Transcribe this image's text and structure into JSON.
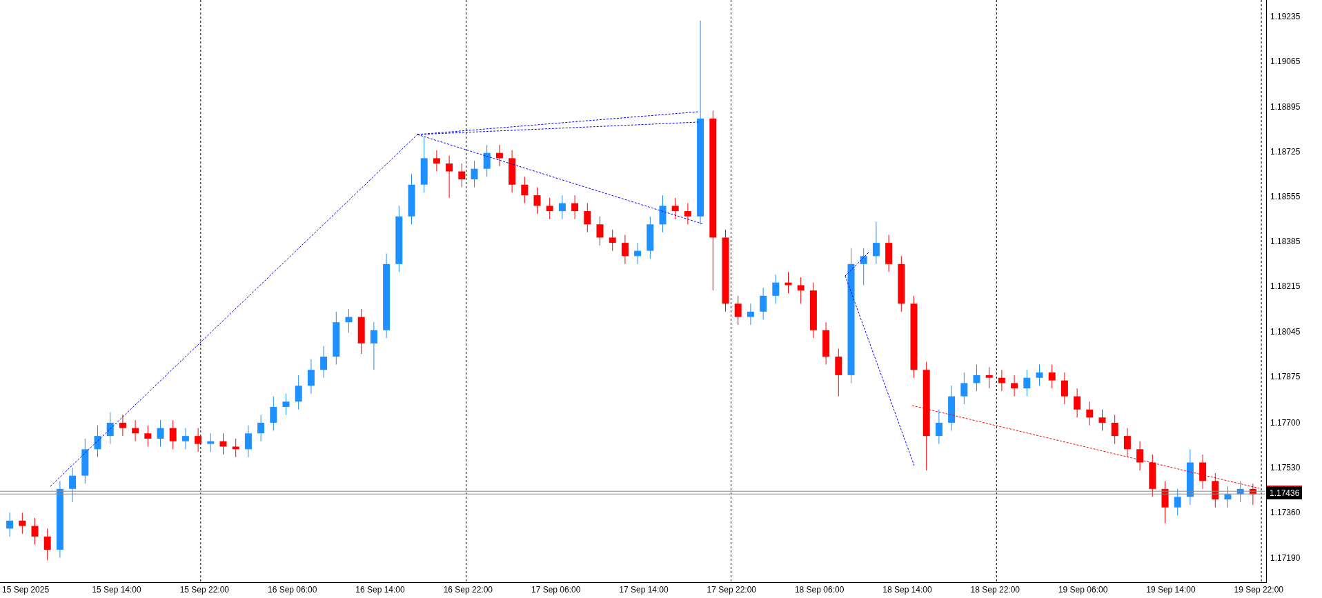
{
  "chart": {
    "chart_data": {
      "type": "candlestick",
      "ylim": [
        1.17095,
        1.19298
      ],
      "yticks": [
        {
          "value": 1.19235,
          "label": "1.19235"
        },
        {
          "value": 1.19065,
          "label": "1.19065"
        },
        {
          "value": 1.18895,
          "label": "1.18895"
        },
        {
          "value": 1.18725,
          "label": "1.18725"
        },
        {
          "value": 1.18555,
          "label": "1.18555"
        },
        {
          "value": 1.18385,
          "label": "1.18385"
        },
        {
          "value": 1.18215,
          "label": "1.18215"
        },
        {
          "value": 1.18045,
          "label": "1.18045"
        },
        {
          "value": 1.17875,
          "label": "1.17875"
        },
        {
          "value": 1.177,
          "label": "1.17700"
        },
        {
          "value": 1.1753,
          "label": "1.17530"
        },
        {
          "value": 1.1736,
          "label": "1.17360"
        },
        {
          "value": 1.1719,
          "label": "1.17190"
        }
      ],
      "categories": [
        null,
        null,
        null,
        null,
        null,
        null,
        null,
        null,
        null,
        null,
        null,
        null,
        null,
        null,
        null,
        null,
        null,
        null,
        null,
        null,
        null,
        null,
        null,
        null,
        null,
        null,
        null,
        null,
        null,
        null,
        null,
        null,
        null,
        null,
        null,
        null,
        null,
        null,
        null,
        null,
        null,
        null,
        null,
        null,
        null,
        null,
        null,
        null,
        null,
        null,
        null,
        null,
        null,
        null,
        null,
        null,
        null,
        null,
        null,
        null,
        null,
        null,
        null,
        null,
        null,
        null,
        null,
        null,
        null,
        null,
        null,
        null,
        null,
        null,
        null,
        null,
        null,
        null,
        null,
        null,
        null,
        null,
        null,
        null,
        null,
        null,
        null,
        null,
        null,
        null,
        null,
        null,
        null,
        null,
        null,
        null,
        null,
        null,
        null,
        null
      ],
      "ohlc": [
        [
          1.173,
          1.1736,
          1.1727,
          1.1733
        ],
        [
          1.1733,
          1.1736,
          1.1728,
          1.1731
        ],
        [
          1.1731,
          1.1734,
          1.1724,
          1.1727
        ],
        [
          1.1727,
          1.173,
          1.1718,
          1.1722
        ],
        [
          1.1722,
          1.1748,
          1.1719,
          1.1745
        ],
        [
          1.1745,
          1.1753,
          1.174,
          1.175
        ],
        [
          1.175,
          1.1764,
          1.1747,
          1.176
        ],
        [
          1.176,
          1.1769,
          1.1757,
          1.1765
        ],
        [
          1.1765,
          1.1774,
          1.1762,
          1.177
        ],
        [
          1.177,
          1.1773,
          1.1765,
          1.1768
        ],
        [
          1.1768,
          1.1771,
          1.1763,
          1.1766
        ],
        [
          1.1766,
          1.1769,
          1.1761,
          1.1764
        ],
        [
          1.1764,
          1.1771,
          1.1761,
          1.1768
        ],
        [
          1.1768,
          1.1771,
          1.176,
          1.1763
        ],
        [
          1.1763,
          1.1768,
          1.176,
          1.1765
        ],
        [
          1.1765,
          1.1768,
          1.1759,
          1.1762
        ],
        [
          1.1762,
          1.1766,
          1.1759,
          1.1763
        ],
        [
          1.1763,
          1.1766,
          1.1758,
          1.1761
        ],
        [
          1.1761,
          1.1764,
          1.1757,
          1.176
        ],
        [
          1.176,
          1.1769,
          1.1757,
          1.1766
        ],
        [
          1.1766,
          1.1773,
          1.1763,
          1.177
        ],
        [
          1.177,
          1.178,
          1.1767,
          1.1776
        ],
        [
          1.1776,
          1.1781,
          1.1773,
          1.1778
        ],
        [
          1.1778,
          1.1788,
          1.1775,
          1.1784
        ],
        [
          1.1784,
          1.1794,
          1.1781,
          1.179
        ],
        [
          1.179,
          1.1799,
          1.1787,
          1.1795
        ],
        [
          1.1795,
          1.1812,
          1.1792,
          1.1808
        ],
        [
          1.1808,
          1.1813,
          1.1804,
          1.181
        ],
        [
          1.181,
          1.1813,
          1.1796,
          1.18
        ],
        [
          1.18,
          1.1808,
          1.179,
          1.1805
        ],
        [
          1.1805,
          1.1834,
          1.1802,
          1.183
        ],
        [
          1.183,
          1.1852,
          1.1827,
          1.1848
        ],
        [
          1.1848,
          1.1864,
          1.1845,
          1.186
        ],
        [
          1.186,
          1.1878,
          1.1857,
          1.187
        ],
        [
          1.187,
          1.1873,
          1.1865,
          1.1868
        ],
        [
          1.1868,
          1.1871,
          1.1855,
          1.1865
        ],
        [
          1.1865,
          1.1868,
          1.1859,
          1.1862
        ],
        [
          1.1862,
          1.1869,
          1.1859,
          1.1866
        ],
        [
          1.1866,
          1.1875,
          1.1863,
          1.1872
        ],
        [
          1.1872,
          1.1875,
          1.1867,
          1.187
        ],
        [
          1.187,
          1.1873,
          1.1857,
          1.186
        ],
        [
          1.186,
          1.1863,
          1.1853,
          1.1856
        ],
        [
          1.1856,
          1.1859,
          1.1849,
          1.1852
        ],
        [
          1.1852,
          1.1855,
          1.1847,
          1.185
        ],
        [
          1.185,
          1.1856,
          1.1847,
          1.1853
        ],
        [
          1.1853,
          1.1856,
          1.1847,
          1.185
        ],
        [
          1.185,
          1.1853,
          1.1842,
          1.1845
        ],
        [
          1.1845,
          1.1848,
          1.1837,
          1.184
        ],
        [
          1.184,
          1.1843,
          1.1835,
          1.1838
        ],
        [
          1.1838,
          1.1841,
          1.183,
          1.1833
        ],
        [
          1.1833,
          1.1838,
          1.183,
          1.1835
        ],
        [
          1.1835,
          1.1848,
          1.1832,
          1.1845
        ],
        [
          1.1845,
          1.1856,
          1.1842,
          1.1852
        ],
        [
          1.1852,
          1.1855,
          1.1847,
          1.185
        ],
        [
          1.185,
          1.1853,
          1.1845,
          1.1848
        ],
        [
          1.1848,
          1.1922,
          1.1845,
          1.1885
        ],
        [
          1.1885,
          1.1888,
          1.182,
          1.184
        ],
        [
          1.184,
          1.1843,
          1.1812,
          1.1815
        ],
        [
          1.1815,
          1.1818,
          1.1807,
          1.181
        ],
        [
          1.181,
          1.1815,
          1.1807,
          1.1812
        ],
        [
          1.1812,
          1.1821,
          1.1809,
          1.1818
        ],
        [
          1.1818,
          1.1826,
          1.1815,
          1.1823
        ],
        [
          1.1823,
          1.1827,
          1.1819,
          1.1822
        ],
        [
          1.1822,
          1.1825,
          1.1815,
          1.182
        ],
        [
          1.182,
          1.1823,
          1.1802,
          1.1805
        ],
        [
          1.1805,
          1.1808,
          1.1792,
          1.1795
        ],
        [
          1.1795,
          1.1798,
          1.178,
          1.1788
        ],
        [
          1.1788,
          1.1836,
          1.1785,
          1.183
        ],
        [
          1.183,
          1.1836,
          1.1822,
          1.1833
        ],
        [
          1.1833,
          1.1846,
          1.183,
          1.1838
        ],
        [
          1.1838,
          1.1841,
          1.1827,
          1.183
        ],
        [
          1.183,
          1.1833,
          1.1812,
          1.1815
        ],
        [
          1.1815,
          1.1818,
          1.1787,
          1.179
        ],
        [
          1.179,
          1.1793,
          1.1752,
          1.1765
        ],
        [
          1.1765,
          1.1775,
          1.1762,
          1.177
        ],
        [
          1.177,
          1.1784,
          1.1767,
          1.178
        ],
        [
          1.178,
          1.1789,
          1.1777,
          1.1785
        ],
        [
          1.1785,
          1.1792,
          1.1782,
          1.1788
        ],
        [
          1.1788,
          1.1791,
          1.1783,
          1.1787
        ],
        [
          1.1787,
          1.179,
          1.1782,
          1.1785
        ],
        [
          1.1785,
          1.1788,
          1.178,
          1.1783
        ],
        [
          1.1783,
          1.179,
          1.178,
          1.1787
        ],
        [
          1.1787,
          1.1792,
          1.1784,
          1.1789
        ],
        [
          1.1789,
          1.1792,
          1.1783,
          1.1786
        ],
        [
          1.1786,
          1.1789,
          1.1777,
          1.178
        ],
        [
          1.178,
          1.1783,
          1.1772,
          1.1775
        ],
        [
          1.1775,
          1.1778,
          1.1769,
          1.1772
        ],
        [
          1.1772,
          1.1775,
          1.1767,
          1.177
        ],
        [
          1.177,
          1.1773,
          1.1762,
          1.1765
        ],
        [
          1.1765,
          1.1768,
          1.1757,
          1.176
        ],
        [
          1.176,
          1.1763,
          1.1752,
          1.1755
        ],
        [
          1.1755,
          1.1758,
          1.1742,
          1.1745
        ],
        [
          1.1745,
          1.1748,
          1.1732,
          1.1738
        ],
        [
          1.1738,
          1.1745,
          1.1735,
          1.1742
        ],
        [
          1.1742,
          1.176,
          1.1739,
          1.1755
        ],
        [
          1.1755,
          1.1758,
          1.1745,
          1.1748
        ],
        [
          1.1748,
          1.1751,
          1.1738,
          1.1741
        ],
        [
          1.1741,
          1.1746,
          1.1738,
          1.1743
        ],
        [
          1.1743,
          1.1748,
          1.174,
          1.1745
        ],
        [
          1.1745,
          1.1747,
          1.1739,
          1.1743
        ]
      ]
    }
  },
  "price_axis": {
    "current_price": "1.17436"
  },
  "time_axis": {
    "labels": [
      "15 Sep 2025",
      "15 Sep 14:00",
      "15 Sep 22:00",
      "16 Sep 06:00",
      "16 Sep 14:00",
      "16 Sep 22:00",
      "17 Sep 06:00",
      "17 Sep 14:00",
      "17 Sep 22:00",
      "18 Sep 06:00",
      "18 Sep 14:00",
      "18 Sep 22:00",
      "19 Sep 06:00",
      "19 Sep 14:00",
      "19 Sep 22:00"
    ]
  }
}
